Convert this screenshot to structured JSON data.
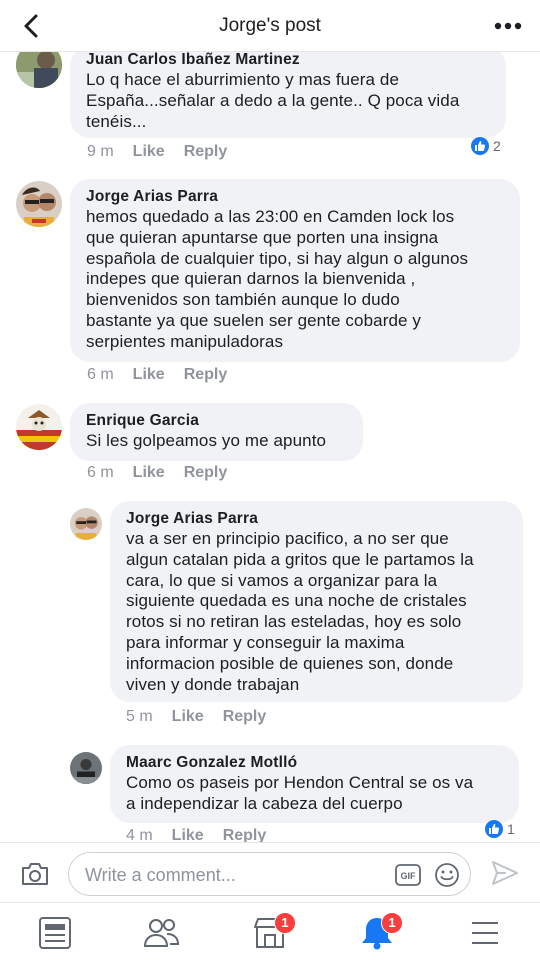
{
  "header": {
    "title": "Jorge's post"
  },
  "comments": [
    {
      "author": "Juan Carlos Ibañez Martinez",
      "lines": [
        "Lo q hace el aburrimiento y mas fuera de",
        "España...señalar a dedo a la gente.. Q poca vida",
        "tenéis..."
      ],
      "time": "9 m",
      "like": "Like",
      "reply": "Reply",
      "reactions": "2"
    },
    {
      "author": "Jorge Arias Parra",
      "lines": [
        "hemos quedado a las 23:00 en Camden lock los",
        "que quieran apuntarse que porten una insigna",
        "española de cualquier tipo, si hay algun o algunos",
        "indepes que quieran darnos la bienvenida ,",
        "bienvenidos son también aunque lo dudo",
        "bastante ya que suelen ser gente cobarde y",
        "serpientes manipuladoras"
      ],
      "time": "6 m",
      "like": "Like",
      "reply": "Reply"
    },
    {
      "author": "Enrique Garcia",
      "lines": [
        "Si les golpeamos yo me apunto"
      ],
      "time": "6 m",
      "like": "Like",
      "reply": "Reply"
    },
    {
      "author": "Jorge Arias Parra",
      "lines": [
        "va a ser en principio pacifico, a no ser que",
        "algun catalan pida a gritos que le partamos la",
        "cara, lo que si vamos a organizar para la",
        "siguiente quedada es una noche de cristales",
        "rotos si no retiran las esteladas, hoy es solo",
        "para informar y conseguir la maxima",
        "informacion posible de quienes son, donde",
        "viven y donde trabajan"
      ],
      "time": "5 m",
      "like": "Like",
      "reply": "Reply"
    },
    {
      "author": "Maarc Gonzalez Motlló",
      "lines": [
        "Como os paseis por Hendon Central se os va",
        "a independizar la cabeza del cuerpo"
      ],
      "time": "4 m",
      "like": "Like",
      "reply": "Reply",
      "reactions": "1"
    }
  ],
  "composer": {
    "placeholder": "Write a comment..."
  },
  "tabbar": {
    "items": [
      "news-feed",
      "friends",
      "marketplace",
      "notifications",
      "menu"
    ],
    "marketplace_badge": "1",
    "notifications_badge": "1"
  },
  "colors": {
    "accent": "#1877f2",
    "bubble": "#f0f2f5",
    "badge": "#fa3e3e",
    "meta": "#90949c"
  }
}
